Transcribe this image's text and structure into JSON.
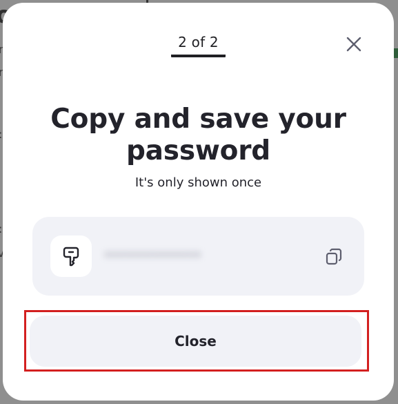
{
  "dialog": {
    "step_label": "2 of 2",
    "title": "Copy and save your password",
    "subtitle": "It's only shown once",
    "password": {
      "value_obscured": "••••••••••••••",
      "copy_icon": "copy-icon",
      "key_icon": "key-icon"
    },
    "close_button_label": "Close",
    "close_icon": "close-icon"
  },
  "colors": {
    "overlay": "#8f8f8f",
    "surface": "#ffffff",
    "card": "#f1f2f7",
    "text": "#23232b",
    "highlight": "#d31f1f"
  }
}
